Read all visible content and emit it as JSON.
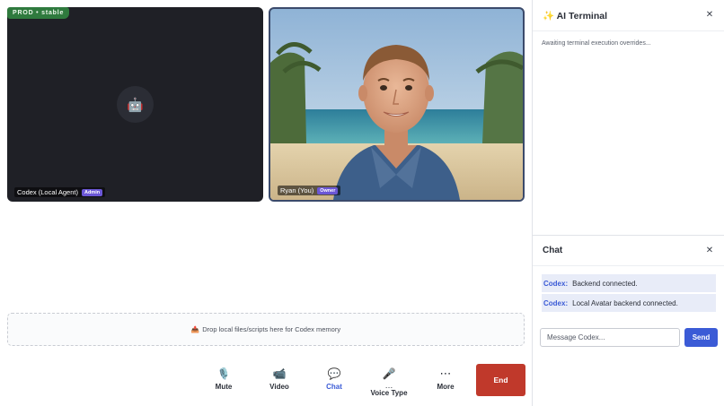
{
  "environment_badge": "PROD • stable",
  "participants": [
    {
      "name": "Codex (Local Agent)",
      "role": "Admin",
      "avatar_icon": "robot-icon"
    },
    {
      "name": "Ryan (You)",
      "role": "Owner"
    }
  ],
  "dropzone": {
    "icon": "upload-icon",
    "label": "Drop local files/scripts here for Codex memory"
  },
  "toolbar": {
    "mute_label": "Mute",
    "video_label": "Video",
    "chat_label": "Chat",
    "voice_label": "Voice Type",
    "more_label": "More",
    "end_label": "End"
  },
  "terminal": {
    "title": "✨ AI Terminal",
    "status": "Awaiting terminal execution overrides..."
  },
  "chat": {
    "title": "Chat",
    "messages": [
      {
        "sender": "Codex:",
        "text": "Backend connected."
      },
      {
        "sender": "Codex:",
        "text": "Local Avatar backend connected."
      }
    ],
    "input_placeholder": "Message Codex...",
    "send_label": "Send"
  },
  "colors": {
    "accent": "#3b5bd6",
    "end": "#c0392b",
    "badge": "#2f7a3e",
    "role": "#6b57d6"
  }
}
